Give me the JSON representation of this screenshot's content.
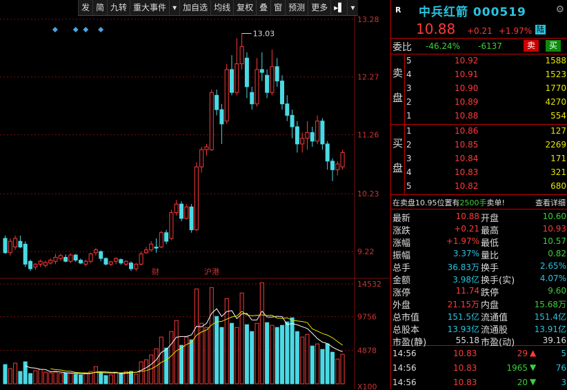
{
  "toolbar": {
    "items": [
      "发",
      "简",
      "九转",
      "重大事件",
      "▾",
      "加自选",
      "均线",
      "复权",
      "叠",
      "窗",
      "预测",
      "更多",
      "▸▌",
      "▾"
    ]
  },
  "chart": {
    "price_axis": [
      "13.28",
      "12.27",
      "11.26",
      "10.23",
      "9.22"
    ],
    "volume_axis": [
      "14532",
      "9756",
      "4878",
      "X100"
    ],
    "high_label": "13.03",
    "event_markers": [
      "财",
      "沪港"
    ]
  },
  "chart_data": {
    "type": "candlestick",
    "ylim": [
      8.8,
      13.35
    ],
    "volume_ylim": [
      0,
      14532
    ],
    "candles": [
      {
        "o": 9.45,
        "c": 9.2,
        "h": 9.5,
        "l": 9.18
      },
      {
        "o": 9.2,
        "c": 9.4,
        "h": 9.45,
        "l": 9.15
      },
      {
        "o": 9.3,
        "c": 9.45,
        "h": 9.5,
        "l": 9.25
      },
      {
        "o": 9.4,
        "c": 9.3,
        "h": 9.5,
        "l": 9.28
      },
      {
        "o": 9.35,
        "c": 9.0,
        "h": 9.4,
        "l": 8.95
      },
      {
        "o": 9.05,
        "c": 8.92,
        "h": 9.08,
        "l": 8.88
      },
      {
        "o": 8.95,
        "c": 9.0,
        "h": 9.02,
        "l": 8.9
      },
      {
        "o": 9.0,
        "c": 9.05,
        "h": 9.08,
        "l": 8.95
      },
      {
        "o": 8.98,
        "c": 9.03,
        "h": 9.06,
        "l": 8.94
      },
      {
        "o": 9.02,
        "c": 9.07,
        "h": 9.1,
        "l": 8.99
      },
      {
        "o": 9.05,
        "c": 9.12,
        "h": 9.18,
        "l": 9.0
      },
      {
        "o": 9.1,
        "c": 9.15,
        "h": 9.18,
        "l": 9.06
      },
      {
        "o": 9.12,
        "c": 9.05,
        "h": 9.17,
        "l": 9.03
      },
      {
        "o": 9.05,
        "c": 9.16,
        "h": 9.19,
        "l": 9.02
      },
      {
        "o": 9.16,
        "c": 9.07,
        "h": 9.18,
        "l": 9.04
      },
      {
        "o": 9.07,
        "c": 9.02,
        "h": 9.1,
        "l": 9.0
      },
      {
        "o": 9.0,
        "c": 9.05,
        "h": 9.08,
        "l": 8.96
      },
      {
        "o": 9.05,
        "c": 9.18,
        "h": 9.2,
        "l": 9.02
      },
      {
        "o": 9.2,
        "c": 9.25,
        "h": 9.28,
        "l": 9.15
      },
      {
        "o": 9.22,
        "c": 9.1,
        "h": 9.24,
        "l": 9.05
      },
      {
        "o": 9.1,
        "c": 9.0,
        "h": 9.12,
        "l": 8.98
      },
      {
        "o": 9.0,
        "c": 9.04,
        "h": 9.06,
        "l": 8.97
      },
      {
        "o": 9.05,
        "c": 9.1,
        "h": 9.12,
        "l": 9.0
      },
      {
        "o": 9.08,
        "c": 9.02,
        "h": 9.1,
        "l": 8.99
      },
      {
        "o": 9.0,
        "c": 9.05,
        "h": 9.07,
        "l": 8.97
      },
      {
        "o": 9.02,
        "c": 8.92,
        "h": 9.05,
        "l": 8.88
      },
      {
        "o": 8.92,
        "c": 9.0,
        "h": 9.02,
        "l": 8.88
      },
      {
        "o": 9.0,
        "c": 9.18,
        "h": 9.22,
        "l": 8.98
      },
      {
        "o": 9.2,
        "c": 9.25,
        "h": 9.3,
        "l": 9.18
      },
      {
        "o": 9.25,
        "c": 9.35,
        "h": 9.4,
        "l": 9.22
      },
      {
        "o": 9.3,
        "c": 9.28,
        "h": 9.45,
        "l": 9.2
      },
      {
        "o": 9.3,
        "c": 9.55,
        "h": 9.58,
        "l": 9.28
      },
      {
        "o": 9.55,
        "c": 9.4,
        "h": 9.6,
        "l": 9.35
      },
      {
        "o": 9.45,
        "c": 9.9,
        "h": 9.95,
        "l": 9.42
      },
      {
        "o": 9.9,
        "c": 10.05,
        "h": 10.12,
        "l": 9.85
      },
      {
        "o": 10.05,
        "c": 9.8,
        "h": 10.1,
        "l": 9.75
      },
      {
        "o": 9.8,
        "c": 10.0,
        "h": 10.05,
        "l": 9.78
      },
      {
        "o": 10.0,
        "c": 9.6,
        "h": 10.05,
        "l": 9.55
      },
      {
        "o": 9.6,
        "c": 10.7,
        "h": 10.78,
        "l": 9.58
      },
      {
        "o": 10.7,
        "c": 11.0,
        "h": 11.05,
        "l": 10.6
      },
      {
        "o": 11.0,
        "c": 11.05,
        "h": 11.1,
        "l": 10.9
      },
      {
        "o": 11.0,
        "c": 12.0,
        "h": 12.05,
        "l": 10.98
      },
      {
        "o": 11.95,
        "c": 11.7,
        "h": 12.05,
        "l": 11.6
      },
      {
        "o": 11.7,
        "c": 11.45,
        "h": 11.8,
        "l": 11.1
      },
      {
        "o": 11.5,
        "c": 12.4,
        "h": 12.5,
        "l": 11.45
      },
      {
        "o": 12.4,
        "c": 12.0,
        "h": 12.65,
        "l": 11.95
      },
      {
        "o": 12.0,
        "c": 12.5,
        "h": 12.95,
        "l": 11.95
      },
      {
        "o": 12.5,
        "c": 12.8,
        "h": 13.03,
        "l": 12.4
      },
      {
        "o": 12.6,
        "c": 12.1,
        "h": 12.7,
        "l": 11.9
      },
      {
        "o": 12.0,
        "c": 11.8,
        "h": 12.1,
        "l": 11.7
      },
      {
        "o": 11.8,
        "c": 12.4,
        "h": 12.6,
        "l": 11.75
      },
      {
        "o": 12.4,
        "c": 12.35,
        "h": 12.7,
        "l": 12.2
      },
      {
        "o": 12.3,
        "c": 12.0,
        "h": 12.4,
        "l": 11.9
      },
      {
        "o": 12.0,
        "c": 12.45,
        "h": 12.75,
        "l": 11.95
      },
      {
        "o": 12.45,
        "c": 12.2,
        "h": 12.6,
        "l": 12.1
      },
      {
        "o": 12.2,
        "c": 11.8,
        "h": 12.3,
        "l": 11.7
      },
      {
        "o": 11.8,
        "c": 11.6,
        "h": 11.95,
        "l": 11.5
      },
      {
        "o": 11.6,
        "c": 11.4,
        "h": 11.7,
        "l": 11.2
      },
      {
        "o": 11.4,
        "c": 11.1,
        "h": 11.5,
        "l": 10.95
      },
      {
        "o": 11.1,
        "c": 11.2,
        "h": 11.3,
        "l": 10.95
      },
      {
        "o": 11.2,
        "c": 11.3,
        "h": 11.5,
        "l": 11.0
      },
      {
        "o": 11.3,
        "c": 11.15,
        "h": 11.4,
        "l": 11.05
      },
      {
        "o": 11.15,
        "c": 11.5,
        "h": 11.6,
        "l": 11.1
      },
      {
        "o": 11.5,
        "c": 11.1,
        "h": 11.55,
        "l": 11.0
      },
      {
        "o": 11.1,
        "c": 10.8,
        "h": 11.15,
        "l": 10.65
      },
      {
        "o": 10.8,
        "c": 10.65,
        "h": 10.85,
        "l": 10.45
      },
      {
        "o": 10.65,
        "c": 10.75,
        "h": 10.8,
        "l": 10.55
      },
      {
        "o": 10.7,
        "c": 10.95,
        "h": 11.0,
        "l": 10.65
      }
    ],
    "volume": [
      {
        "v": 2800,
        "up": false
      },
      {
        "v": 2200,
        "up": true
      },
      {
        "v": 3000,
        "up": true
      },
      {
        "v": 1800,
        "up": false
      },
      {
        "v": 3200,
        "up": false
      },
      {
        "v": 1500,
        "up": false
      },
      {
        "v": 1900,
        "up": true
      },
      {
        "v": 2100,
        "up": true
      },
      {
        "v": 1700,
        "up": true
      },
      {
        "v": 1600,
        "up": true
      },
      {
        "v": 1700,
        "up": true
      },
      {
        "v": 1500,
        "up": true
      },
      {
        "v": 1600,
        "up": false
      },
      {
        "v": 1500,
        "up": true
      },
      {
        "v": 1400,
        "up": false
      },
      {
        "v": 1300,
        "up": false
      },
      {
        "v": 1500,
        "up": true
      },
      {
        "v": 1800,
        "up": true
      },
      {
        "v": 2500,
        "up": true
      },
      {
        "v": 1600,
        "up": false
      },
      {
        "v": 1200,
        "up": false
      },
      {
        "v": 1300,
        "up": true
      },
      {
        "v": 1700,
        "up": true
      },
      {
        "v": 1600,
        "up": false
      },
      {
        "v": 1800,
        "up": true
      },
      {
        "v": 1800,
        "up": false
      },
      {
        "v": 1400,
        "up": true
      },
      {
        "v": 3200,
        "up": true
      },
      {
        "v": 3500,
        "up": true
      },
      {
        "v": 4200,
        "up": true
      },
      {
        "v": 5100,
        "up": true
      },
      {
        "v": 6800,
        "up": true
      },
      {
        "v": 5200,
        "up": false
      },
      {
        "v": 7600,
        "up": true
      },
      {
        "v": 9200,
        "up": true
      },
      {
        "v": 5600,
        "up": false
      },
      {
        "v": 6800,
        "up": true
      },
      {
        "v": 6400,
        "up": false
      },
      {
        "v": 13800,
        "up": true
      },
      {
        "v": 8800,
        "up": true
      },
      {
        "v": 8200,
        "up": true
      },
      {
        "v": 14000,
        "up": true
      },
      {
        "v": 9800,
        "up": false
      },
      {
        "v": 8200,
        "up": false
      },
      {
        "v": 12400,
        "up": true
      },
      {
        "v": 8800,
        "up": false
      },
      {
        "v": 8200,
        "up": true
      },
      {
        "v": 13200,
        "up": true
      },
      {
        "v": 8600,
        "up": false
      },
      {
        "v": 7600,
        "up": false
      },
      {
        "v": 8800,
        "up": true
      },
      {
        "v": 14700,
        "up": true
      },
      {
        "v": 8900,
        "up": false
      },
      {
        "v": 8500,
        "up": true
      },
      {
        "v": 8200,
        "up": false
      },
      {
        "v": 8500,
        "up": false
      },
      {
        "v": 9000,
        "up": false
      },
      {
        "v": 9600,
        "up": false
      },
      {
        "v": 7600,
        "up": false
      },
      {
        "v": 6800,
        "up": true
      },
      {
        "v": 7200,
        "up": true
      },
      {
        "v": 5500,
        "up": false
      },
      {
        "v": 5800,
        "up": true
      },
      {
        "v": 5000,
        "up": false
      },
      {
        "v": 5800,
        "up": false
      },
      {
        "v": 4600,
        "up": false
      },
      {
        "v": 3600,
        "up": true
      },
      {
        "v": 4300,
        "up": true
      }
    ],
    "markers_at": [
      8,
      14,
      16,
      19
    ]
  },
  "quote": {
    "r_badge": "R",
    "name": "中兵红箭 000519",
    "price": "10.88",
    "change": "+0.21",
    "change_pct": "+1.97%",
    "market": "陆",
    "weibi_label": "委比",
    "weibi_value": "-46.24%",
    "weibi_diff": "-6137",
    "sell_button": "卖",
    "buy_button": "买",
    "ask_label": [
      "卖",
      "盘"
    ],
    "bid_label": [
      "买",
      "盘"
    ],
    "asks": [
      {
        "level": "5",
        "price": "10.92",
        "qty": "1588"
      },
      {
        "level": "4",
        "price": "10.91",
        "qty": "1523"
      },
      {
        "level": "3",
        "price": "10.90",
        "qty": "1770"
      },
      {
        "level": "2",
        "price": "10.89",
        "qty": "4270"
      },
      {
        "level": "1",
        "price": "10.88",
        "qty": "554"
      }
    ],
    "bids": [
      {
        "level": "1",
        "price": "10.86",
        "qty": "127"
      },
      {
        "level": "2",
        "price": "10.85",
        "qty": "2269"
      },
      {
        "level": "3",
        "price": "10.84",
        "qty": "171"
      },
      {
        "level": "4",
        "price": "10.83",
        "qty": "321"
      },
      {
        "level": "5",
        "price": "10.82",
        "qty": "680"
      }
    ],
    "notice_prefix": "在卖盘10.95位置有",
    "notice_qty": "2500手",
    "notice_suffix": "卖单!",
    "view_detail": "查看详细",
    "stats": [
      {
        "k1": "最新",
        "v1": "10.88",
        "c1": "red",
        "k2": "开盘",
        "v2": "10.60",
        "c2": "green"
      },
      {
        "k1": "涨跌",
        "v1": "+0.21",
        "c1": "red",
        "k2": "最高",
        "v2": "10.93",
        "c2": "red"
      },
      {
        "k1": "涨幅",
        "v1": "+1.97%",
        "c1": "red",
        "k2": "最低",
        "v2": "10.57",
        "c2": "green"
      },
      {
        "k1": "振幅",
        "v1": "3.37%",
        "c1": "cyan",
        "k2": "量比",
        "v2": "0.82",
        "c2": "green"
      },
      {
        "k1": "总手",
        "v1": "36.83万",
        "c1": "cyan",
        "k2": "换手",
        "v2": "2.65%",
        "c2": "cyan"
      },
      {
        "k1": "金额",
        "v1": "3.98亿",
        "c1": "cyan",
        "k2": "换手(实)",
        "v2": "4.07%",
        "c2": "cyan"
      },
      {
        "k1": "涨停",
        "v1": "11.74",
        "c1": "red",
        "k2": "跌停",
        "v2": "9.60",
        "c2": "green"
      },
      {
        "k1": "外盘",
        "v1": "21.15万",
        "c1": "red",
        "k2": "内盘",
        "v2": "15.68万",
        "c2": "green"
      },
      {
        "k1": "总市值",
        "v1": "151.5亿",
        "c1": "cyan",
        "k2": "流通值",
        "v2": "151.4亿",
        "c2": "cyan"
      },
      {
        "k1": "总股本",
        "v1": "13.93亿",
        "c1": "cyan",
        "k2": "流通股",
        "v2": "13.91亿",
        "c2": "cyan"
      },
      {
        "k1": "市盈(静)",
        "v1": "55.18",
        "c1": "white",
        "k2": "市盈(动)",
        "v2": "39.16",
        "c2": "white"
      }
    ],
    "ticks": [
      {
        "time": "14:56",
        "price": "10.83",
        "vol": "29",
        "dir": "up",
        "num": "5"
      },
      {
        "time": "14:56",
        "price": "10.83",
        "vol": "1965",
        "dir": "down",
        "num": "76"
      },
      {
        "time": "14:56",
        "price": "10.83",
        "vol": "20",
        "dir": "down",
        "num": "3"
      }
    ]
  },
  "colors": {
    "up": "#ff3a3a",
    "down": "#4ad9e4",
    "marker": "#4aa3df",
    "grid": "#7a1010"
  }
}
